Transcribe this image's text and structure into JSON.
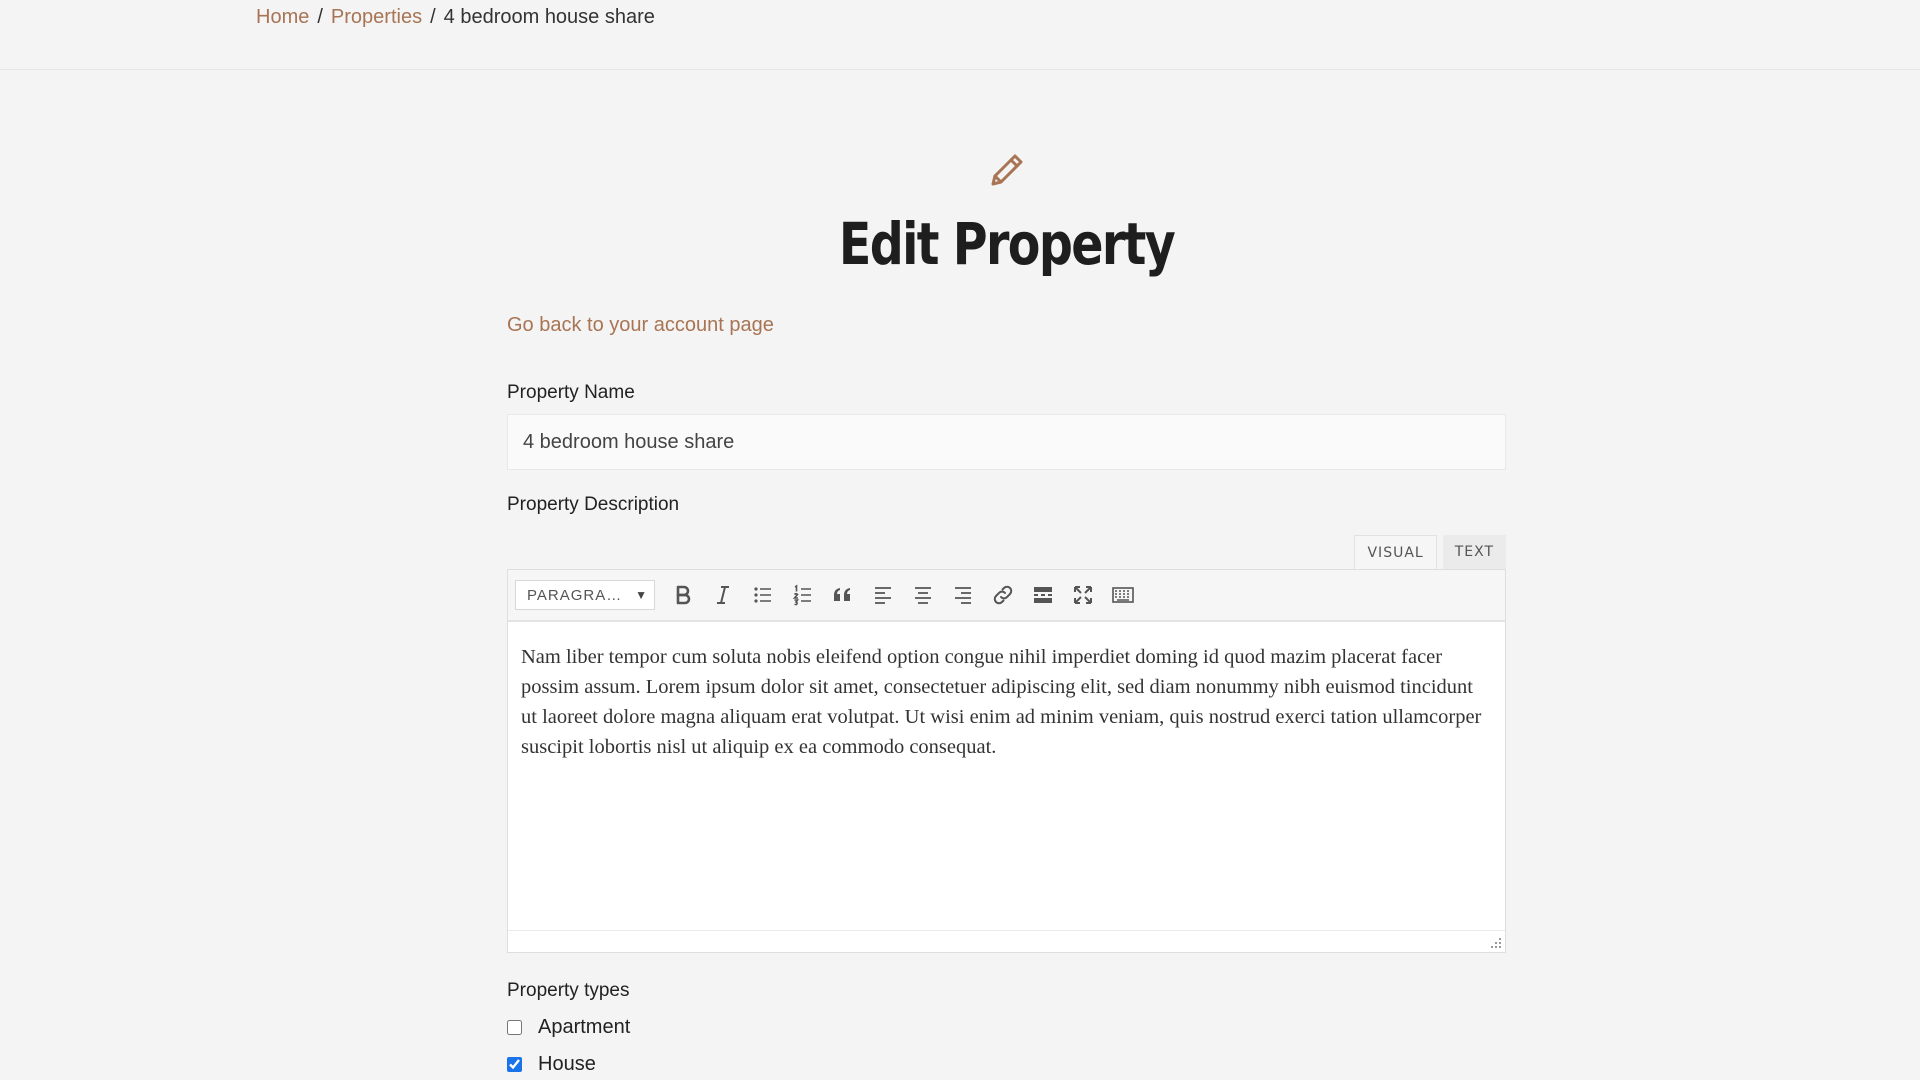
{
  "breadcrumb": {
    "home": "Home",
    "properties": "Properties",
    "separator": "/",
    "current": "4 bedroom house share"
  },
  "page": {
    "title": "Edit Property",
    "back_link": "Go back to your account page",
    "header_icon": "pencil-icon"
  },
  "form": {
    "name_label": "Property Name",
    "name_value": "4 bedroom house share",
    "description_label": "Property Description",
    "types_label": "Property types",
    "types": [
      {
        "label": "Apartment",
        "checked": false
      },
      {
        "label": "House",
        "checked": true
      }
    ]
  },
  "editor": {
    "tabs": {
      "visual": "VISUAL",
      "text": "TEXT"
    },
    "active_tab": "visual",
    "format_select": "PARAGRA…",
    "toolbar": [
      "bold-icon",
      "italic-icon",
      "bullet-list-icon",
      "numbered-list-icon",
      "blockquote-icon",
      "align-left-icon",
      "align-center-icon",
      "align-right-icon",
      "link-icon",
      "read-more-icon",
      "fullscreen-icon",
      "toolbar-toggle-icon"
    ],
    "content": "Nam liber tempor cum soluta nobis eleifend option congue nihil imperdiet doming id quod mazim placerat facer possim assum. Lorem ipsum dolor sit amet, consectetuer adipiscing elit, sed diam nonummy nibh euismod tincidunt ut laoreet dolore magna aliquam erat volutpat. Ut wisi enim ad minim veniam, quis nostrud exerci tation ullamcorper suscipit lobortis nisl ut aliquip ex ea commodo consequat."
  },
  "colors": {
    "accent": "#a87454",
    "background": "#f4f4f4",
    "checkbox": "#1a73e8"
  }
}
